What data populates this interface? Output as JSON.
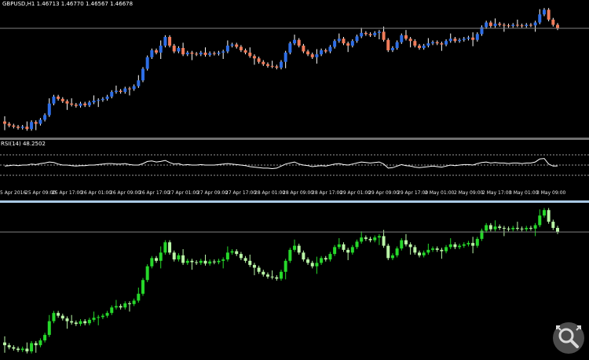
{
  "chart_header": {
    "symbol": "GBPUSD,H1",
    "ohlc": "1.46713 1.46770 1.46567 1.46678"
  },
  "rsi_header": "RSI(14) 48.2502",
  "time_axis": [
    "5 Apr 2016",
    "25 Apr 09:00",
    "25 Apr 17:00",
    "26 Apr 01:00",
    "26 Apr 09:00",
    "26 Apr 17:00",
    "27 Apr 01:00",
    "27 Apr 09:00",
    "27 Apr 17:00",
    "28 Apr 01:00",
    "28 Apr 09:00",
    "28 Apr 17:00",
    "29 Apr 01:00",
    "29 Apr 09:00",
    "29 Apr 17:00",
    "2 May 01:00",
    "2 May 09:00",
    "2 May 17:00",
    "3 May 01:00",
    "3 May 09:00"
  ],
  "colors": {
    "bull": "#2e6ee6",
    "bear": "#f07c5a",
    "wick": "#ffffff",
    "lower_bull": "#26d82a",
    "lower_bear": "#b9f5a6",
    "rsi_line": "#ffffff",
    "level_line": "#808080"
  },
  "icons": {
    "zoom": "zoom-magnifier-icon"
  },
  "chart_data": {
    "type": "candlestick",
    "symbol": "GBPUSD",
    "timeframe": "H1",
    "close_series": [
      1.4505,
      1.4502,
      1.45,
      1.4498,
      1.45,
      1.4496,
      1.4508,
      1.4505,
      1.4512,
      1.452,
      1.454,
      1.4552,
      1.4548,
      1.4544,
      1.454,
      1.4538,
      1.4536,
      1.454,
      1.4537,
      1.4542,
      1.4545,
      1.4546,
      1.4548,
      1.4552,
      1.456,
      1.4562,
      1.456,
      1.4566,
      1.4565,
      1.457,
      1.458,
      1.46,
      1.462,
      1.4632,
      1.4628,
      1.464,
      1.4655,
      1.464,
      1.463,
      1.4636,
      1.4625,
      1.4628,
      1.4626,
      1.4625,
      1.4628,
      1.4624,
      1.4627,
      1.4626,
      1.4628,
      1.463,
      1.464,
      1.4642,
      1.4638,
      1.4632,
      1.4628,
      1.4622,
      1.4618,
      1.4612,
      1.4608,
      1.4605,
      1.4604,
      1.4602,
      1.4612,
      1.4628,
      1.4644,
      1.465,
      1.464,
      1.463,
      1.4625,
      1.462,
      1.4625,
      1.4632,
      1.463,
      1.4638,
      1.4648,
      1.4652,
      1.4644,
      1.464,
      1.4648,
      1.4656,
      1.4662,
      1.466,
      1.4658,
      1.4662,
      1.4664,
      1.465,
      1.4632,
      1.4636,
      1.4646,
      1.4658,
      1.4652,
      1.4648,
      1.464,
      1.4636,
      1.464,
      1.4644,
      1.4646,
      1.4644,
      1.4642,
      1.4648,
      1.4652,
      1.4648,
      1.465,
      1.4652,
      1.4654,
      1.465,
      1.466,
      1.4672,
      1.468,
      1.4674,
      1.4678,
      1.4676,
      1.4675,
      1.4674,
      1.4676,
      1.4675,
      1.4674,
      1.4676,
      1.4675,
      1.468,
      1.4694,
      1.4702,
      1.4685,
      1.4676,
      1.467
    ],
    "rsi_series": [
      48,
      49,
      50,
      49,
      50,
      50,
      52,
      51,
      53,
      54,
      56,
      55,
      52,
      50,
      50,
      49,
      48,
      49,
      49,
      50,
      50,
      51,
      52,
      53,
      53,
      52,
      52,
      53,
      51,
      50,
      50,
      53,
      57,
      58,
      56,
      57,
      59,
      55,
      52,
      53,
      50,
      51,
      50,
      50,
      51,
      50,
      50,
      50,
      51,
      52,
      53,
      52,
      51,
      50,
      49,
      47,
      46,
      45,
      44,
      44,
      43,
      44,
      48,
      52,
      54,
      56,
      52,
      50,
      49,
      47,
      48,
      49,
      48,
      50,
      52,
      53,
      51,
      50,
      52,
      54,
      56,
      55,
      54,
      55,
      56,
      52,
      44,
      45,
      48,
      51,
      49,
      48,
      46,
      45,
      46,
      47,
      48,
      47,
      46,
      48,
      50,
      49,
      50,
      51,
      51,
      50,
      53,
      55,
      56,
      54,
      55,
      54,
      54,
      53,
      54,
      54,
      53,
      54,
      54,
      56,
      62,
      63,
      52,
      48,
      48.2502
    ],
    "rsi_levels": [
      70,
      50,
      30
    ]
  }
}
